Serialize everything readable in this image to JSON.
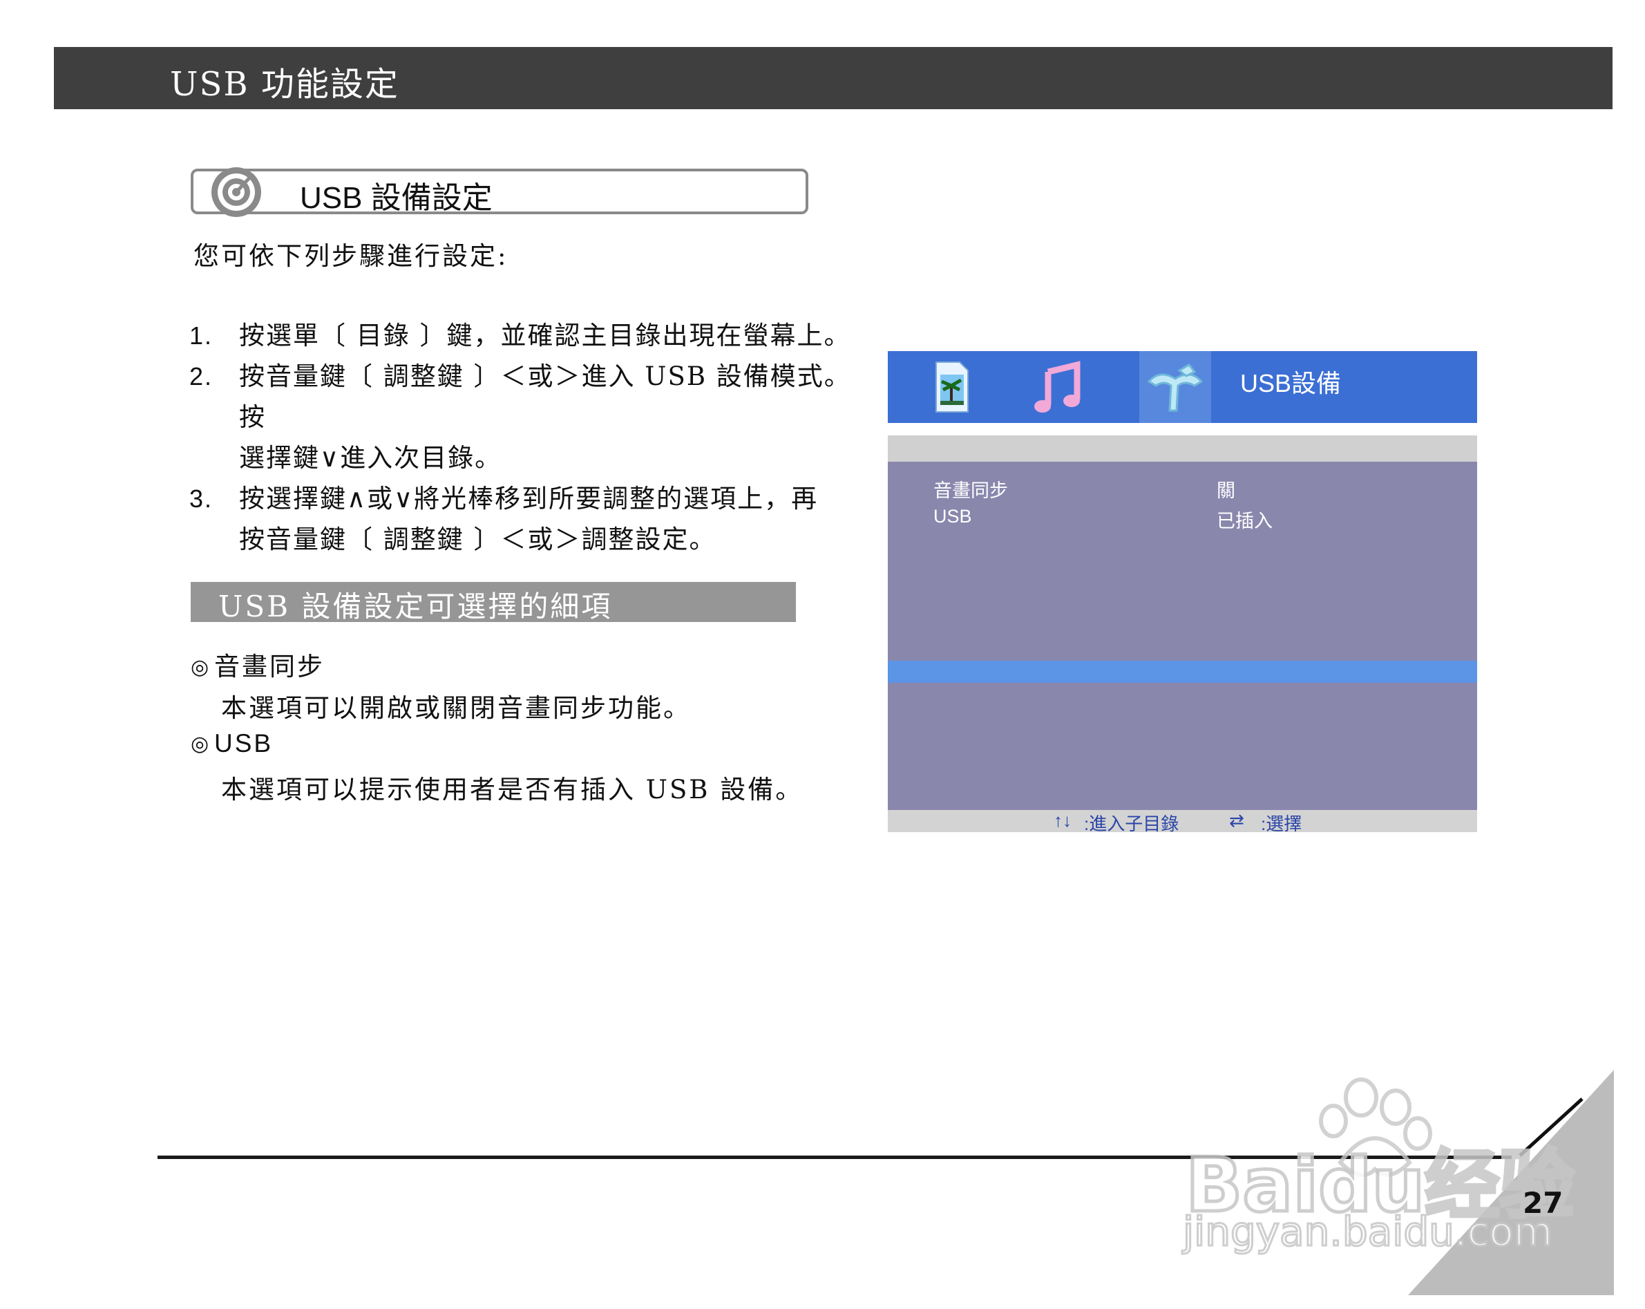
{
  "header": {
    "title": "USB 功能設定"
  },
  "section": {
    "title": "USB 設備設定"
  },
  "intro": "您可依下列步驟進行設定:",
  "steps": [
    {
      "num": "1.",
      "line1": "按選單〔 目錄 〕鍵，並確認主目錄出現在螢幕上。",
      "line2": ""
    },
    {
      "num": "2.",
      "line1": "按音量鍵〔 調整鍵 〕＜或＞進入 USB 設備模式。按",
      "line2": "選擇鍵∨進入次目錄。"
    },
    {
      "num": "3.",
      "line1": "按選擇鍵∧或∨將光棒移到所要調整的選項上，再",
      "line2": "按音量鍵〔 調整鍵 〕＜或＞調整設定。"
    }
  ],
  "options_header": "USB 設備設定可選擇的細項",
  "features": [
    {
      "mark": "◎",
      "title": "音畫同步",
      "desc": "本選項可以開啟或關閉音畫同步功能。"
    },
    {
      "mark": "◎",
      "title": "USB",
      "desc": "本選項可以提示使用者是否有插入 USB 設備。"
    }
  ],
  "osd": {
    "title": "USB設備",
    "tabs": [
      "photo-icon",
      "music-icon",
      "settings-icon"
    ],
    "rows": [
      {
        "label": "音畫同步",
        "value": "關"
      },
      {
        "label": "USB",
        "value": "已插入"
      }
    ],
    "hint_enter_icon": "↑↓",
    "hint_enter": ":進入子目錄",
    "hint_select_icon": "⇄",
    "hint_select": ":選擇"
  },
  "footer": {
    "page_number": "27"
  },
  "watermark": {
    "text": "Baidu经验",
    "url_text": "jingyan.baidu.com"
  },
  "colors": {
    "header_bg": "#3f3f3f",
    "osd_bg": "#8a87ad",
    "osd_top": "#3c6fd4",
    "osd_highlight": "#5c94e6",
    "osd_hint": "#2a45a8"
  }
}
